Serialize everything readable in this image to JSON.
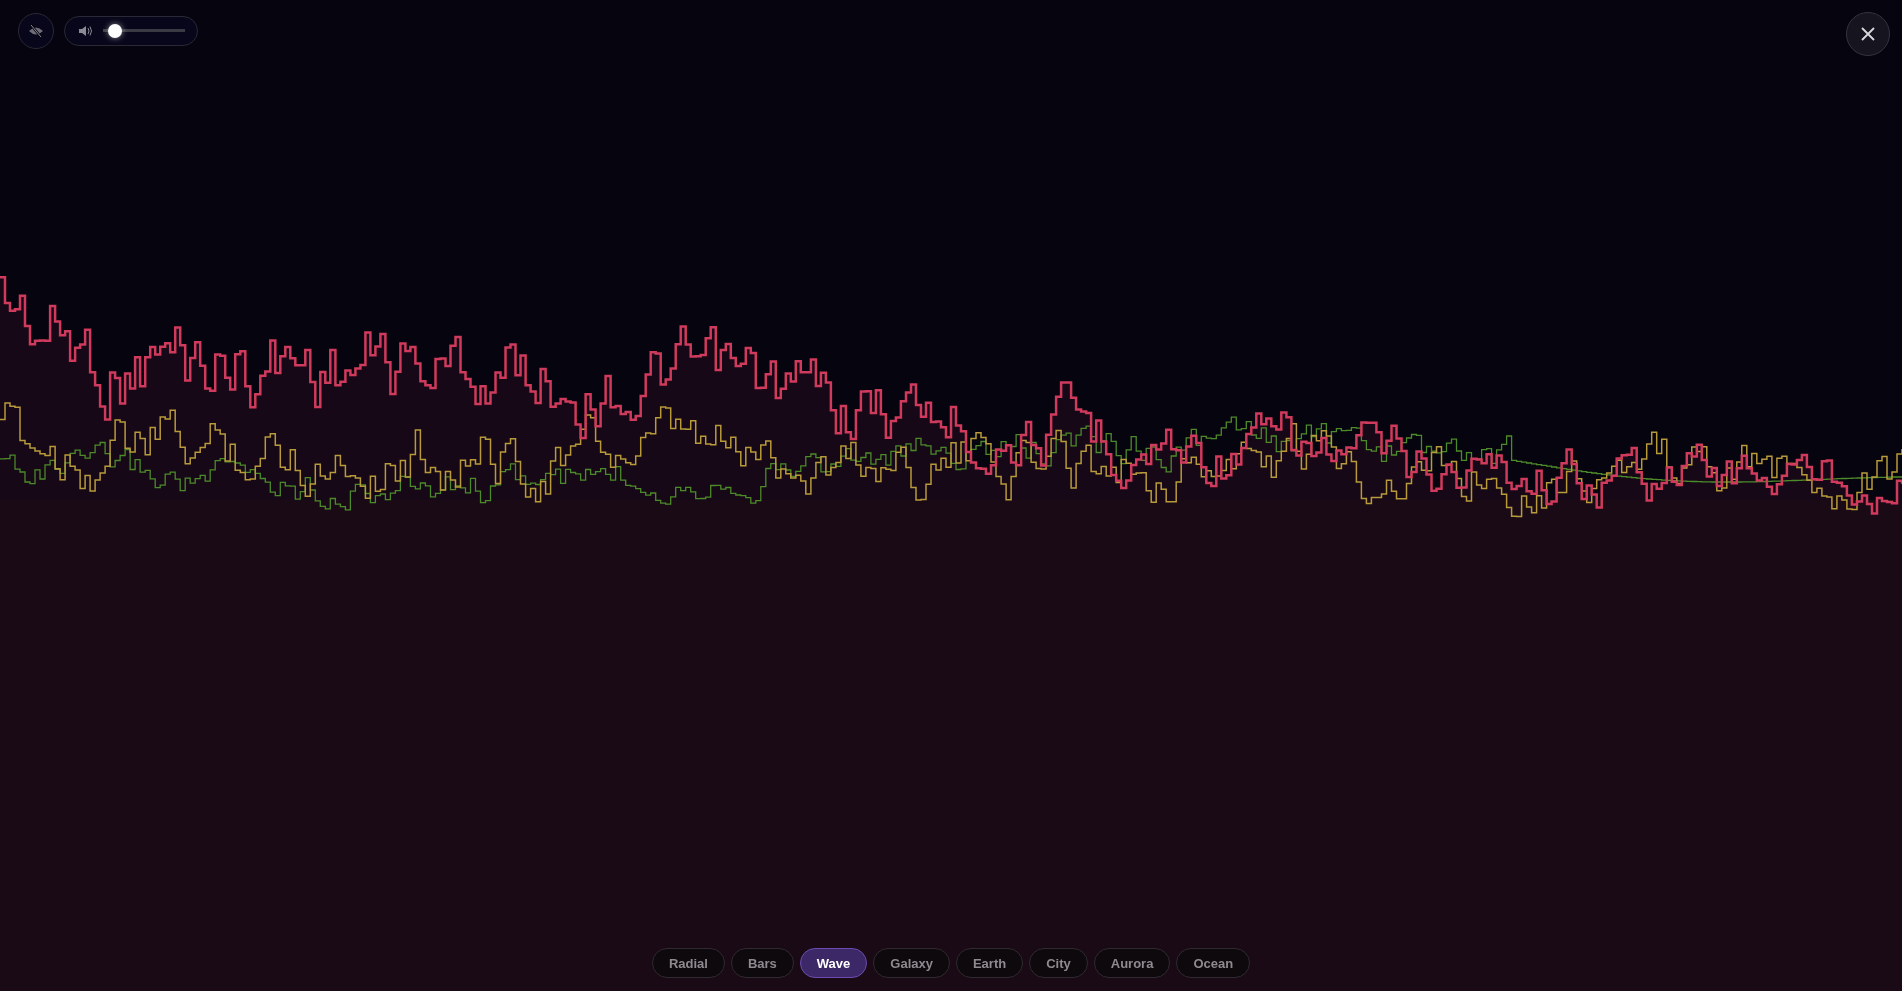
{
  "volume": {
    "level": 0.08
  },
  "modes": [
    {
      "label": "Radial",
      "selected": false
    },
    {
      "label": "Bars",
      "selected": false
    },
    {
      "label": "Wave",
      "selected": true
    },
    {
      "label": "Galaxy",
      "selected": false
    },
    {
      "label": "Earth",
      "selected": false
    },
    {
      "label": "City",
      "selected": false
    },
    {
      "label": "Aurora",
      "selected": false
    },
    {
      "label": "Ocean",
      "selected": false
    }
  ]
}
